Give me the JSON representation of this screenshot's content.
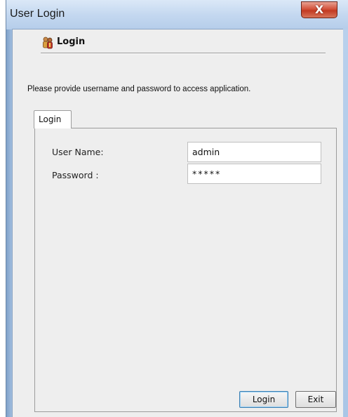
{
  "window": {
    "title": "User Login",
    "close_glyph": "X"
  },
  "header": {
    "icon": "user-group-icon",
    "title": "Login"
  },
  "instructions": "Please provide username and password to access application.",
  "tabs": [
    {
      "label": "Login",
      "selected": true
    }
  ],
  "form": {
    "username_label": "User Name:",
    "username_value": "admin",
    "password_label": "Password :",
    "password_value": "*****"
  },
  "buttons": {
    "login_label": "Login",
    "exit_label": "Exit"
  },
  "colors": {
    "close_button": "#c94a30",
    "default_button_border": "#3c7fb1"
  }
}
